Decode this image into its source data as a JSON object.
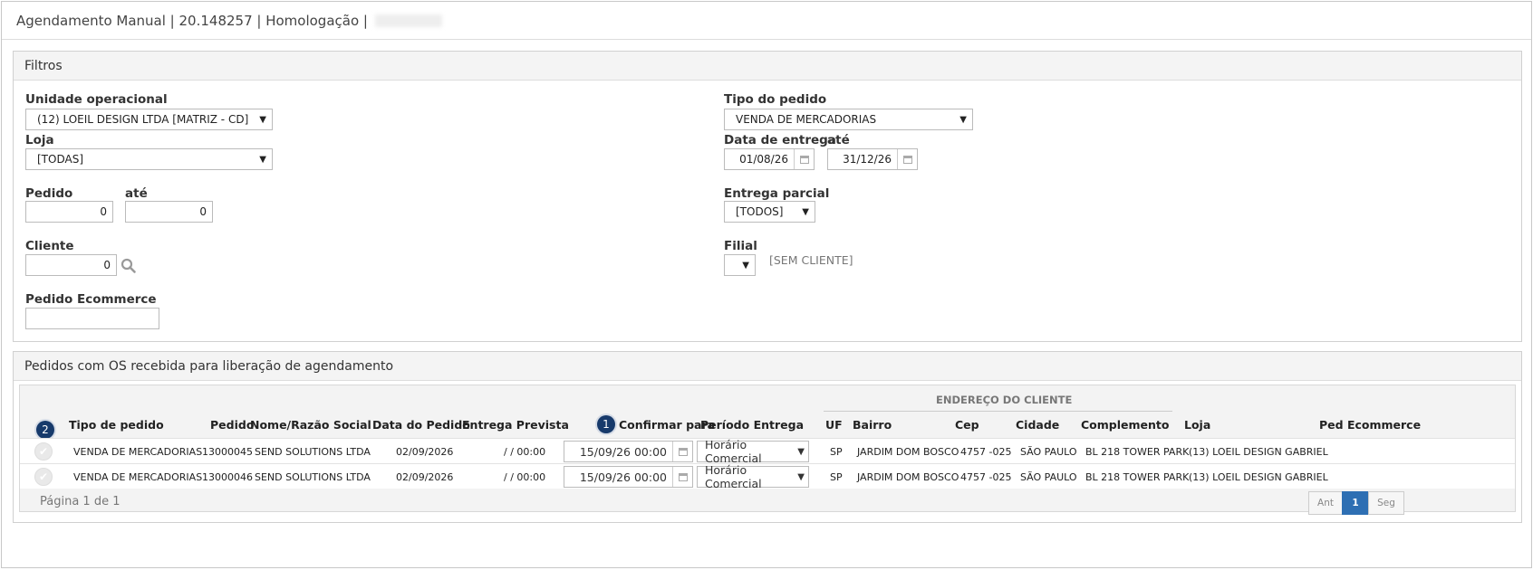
{
  "header": {
    "title": "Agendamento Manual | 20.148257 | Homologação |"
  },
  "filters": {
    "title": "Filtros",
    "unidade": {
      "label": "Unidade operacional",
      "value": "(12) LOEIL DESIGN LTDA [MATRIZ - CD]"
    },
    "loja": {
      "label": "Loja",
      "value": "[TODAS]"
    },
    "pedido": {
      "label": "Pedido",
      "value": "0",
      "ate_label": "até",
      "ate_value": "0"
    },
    "cliente": {
      "label": "Cliente",
      "value": "0"
    },
    "pedido_ecommerce": {
      "label": "Pedido Ecommerce",
      "value": ""
    },
    "tipo_pedido": {
      "label": "Tipo do pedido",
      "value": "VENDA DE MERCADORIAS"
    },
    "data_entrega": {
      "label": "Data de entrega",
      "value": "01/08/26",
      "ate_label": "até",
      "ate_value": "31/12/26"
    },
    "entrega_parcial": {
      "label": "Entrega parcial",
      "value": "[TODOS]"
    },
    "filial": {
      "label": "Filial",
      "value": "",
      "sem_cliente": "[SEM CLIENTE]"
    }
  },
  "orders": {
    "title": "Pedidos com OS recebida para liberação de agendamento",
    "group_header": "ENDEREÇO DO CLIENTE",
    "badge1": "1",
    "badge2": "2",
    "columns": {
      "tipo": "Tipo de pedido",
      "pedido": "Pedido",
      "nome": "Nome/Razão Social",
      "data": "Data do Pedido",
      "entrega": "Entrega Prevista",
      "confirmar": "Confirmar para",
      "periodo": "Período Entrega",
      "uf": "UF",
      "bairro": "Bairro",
      "cep": "Cep",
      "cidade": "Cidade",
      "complemento": "Complemento",
      "loja": "Loja",
      "ped_ecommerce": "Ped Ecommerce"
    },
    "rows": [
      {
        "tipo": "VENDA DE MERCADORIAS",
        "pedido": "13000045",
        "nome": "SEND SOLUTIONS LTDA",
        "data": "02/09/2026",
        "entrega": "/ / 00:00",
        "confirmar": "15/09/26 00:00",
        "periodo": "Horário Comercial",
        "uf": "SP",
        "bairro": "JARDIM DOM BOSCO",
        "cep": "4757 -025",
        "cidade": "SÃO PAULO",
        "complemento": "BL 218 TOWER PARK",
        "loja": "(13) LOEIL DESIGN GABRIEL",
        "ped_ecommerce": ""
      },
      {
        "tipo": "VENDA DE MERCADORIAS",
        "pedido": "13000046",
        "nome": "SEND SOLUTIONS LTDA",
        "data": "02/09/2026",
        "entrega": "/ / 00:00",
        "confirmar": "15/09/26 00:00",
        "periodo": "Horário Comercial",
        "uf": "SP",
        "bairro": "JARDIM DOM BOSCO",
        "cep": "4757 -025",
        "cidade": "SÃO PAULO",
        "complemento": "BL 218 TOWER PARK",
        "loja": "(13) LOEIL DESIGN GABRIEL",
        "ped_ecommerce": ""
      }
    ],
    "footer": "Página 1 de 1",
    "pager": {
      "prev": "Ant",
      "current": "1",
      "next": "Seg"
    }
  },
  "icons": {
    "search": "search-icon",
    "calendar": "calendar-icon",
    "check": "check-icon",
    "caret": "chevron-down-icon"
  }
}
